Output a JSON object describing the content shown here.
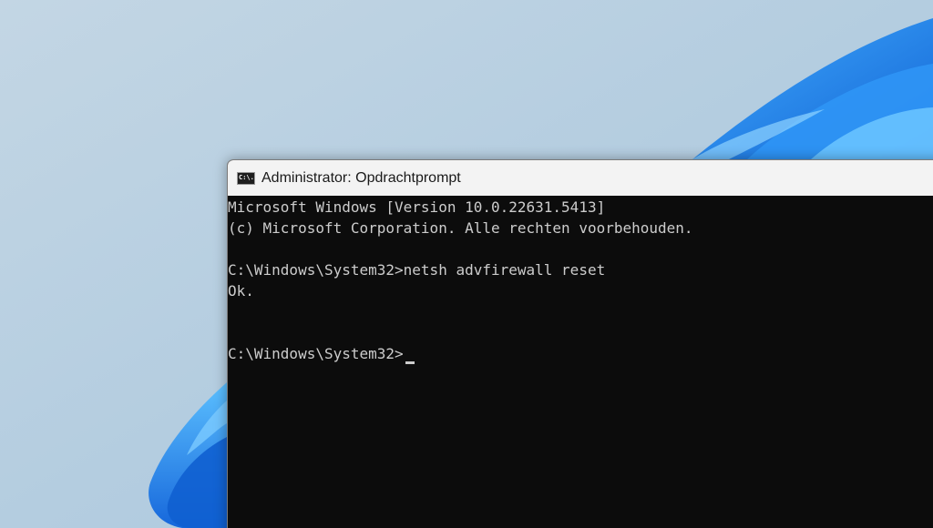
{
  "window": {
    "title": "Administrator: Opdrachtprompt",
    "icon": "cmd-icon",
    "icon_text": "C:\\."
  },
  "console": {
    "lines": [
      "Microsoft Windows [Version 10.0.22631.5413]",
      "(c) Microsoft Corporation. Alle rechten voorbehouden.",
      "",
      "C:\\Windows\\System32>netsh advfirewall reset",
      "Ok.",
      "",
      "",
      "C:\\Windows\\System32>"
    ]
  },
  "colors": {
    "console_background": "#0c0c0c",
    "console_text": "#cccccc",
    "titlebar": "#f3f3f3",
    "wallpaper_light": "#b8d2e4",
    "wallpaper_bloom": "#1b7fe6"
  }
}
